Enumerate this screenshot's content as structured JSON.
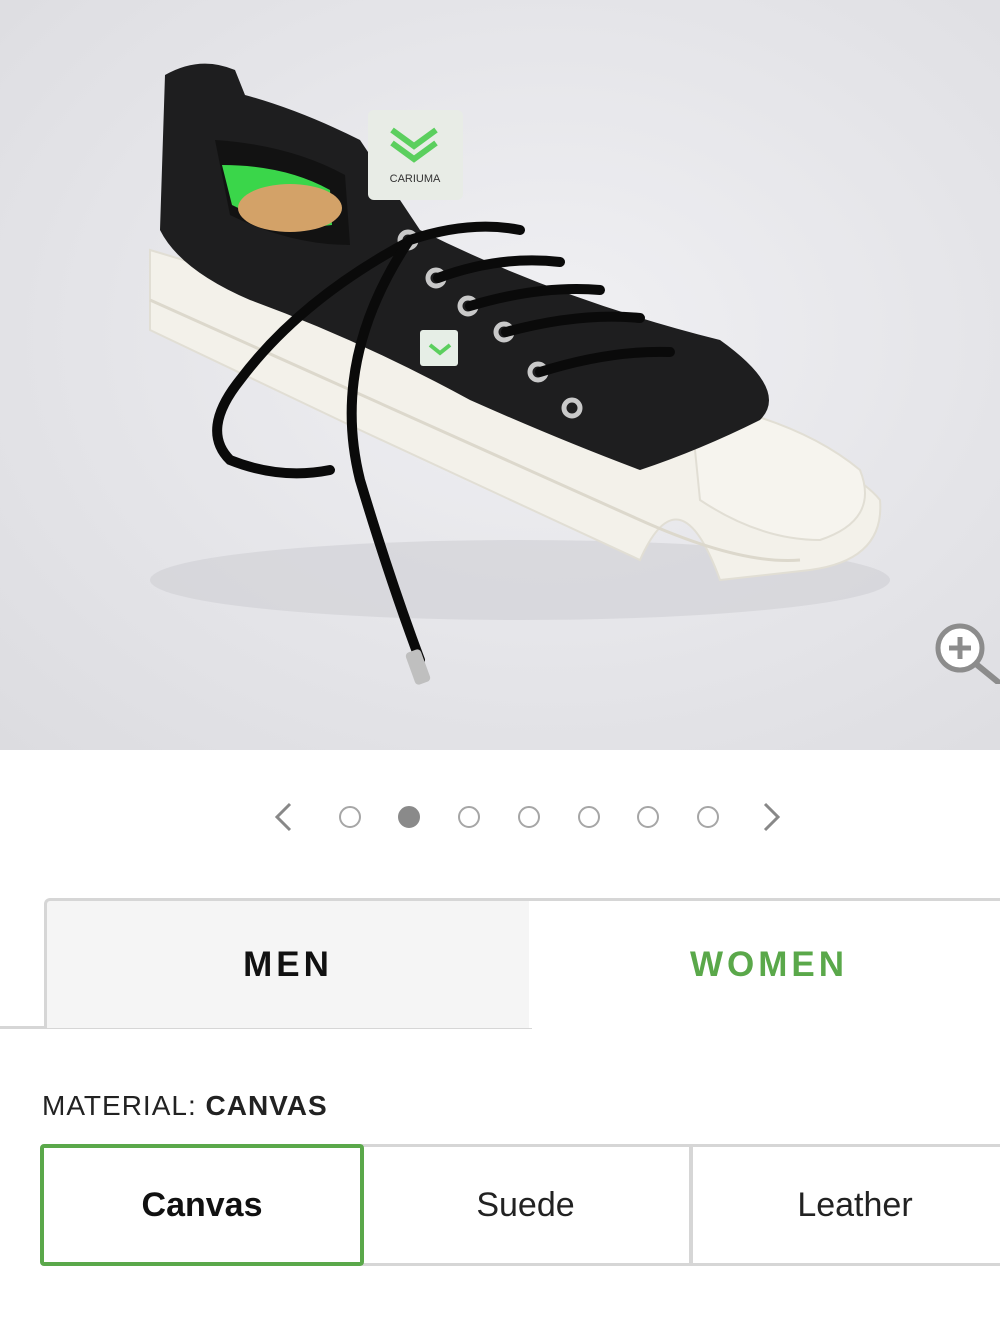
{
  "product_image": {
    "alt_subject": "black canvas low-top sneaker",
    "shoe_label": "CARIUMA",
    "zoom_icon": "zoom-in-icon"
  },
  "carousel": {
    "prev_icon": "chevron-left-icon",
    "next_icon": "chevron-right-icon",
    "slide_count": 7,
    "active_index": 1
  },
  "gender_tabs": [
    {
      "label": "MEN",
      "selected": false
    },
    {
      "label": "WOMEN",
      "selected": true
    }
  ],
  "material": {
    "label": "MATERIAL:",
    "selected_value": "CANVAS",
    "options": [
      "Canvas",
      "Suede",
      "Leather"
    ],
    "selected_index": 0
  },
  "colors": {
    "accent_green": "#5aa84a",
    "border_gray": "#d6d6d6",
    "inactive_tab_bg": "#f5f5f5"
  }
}
